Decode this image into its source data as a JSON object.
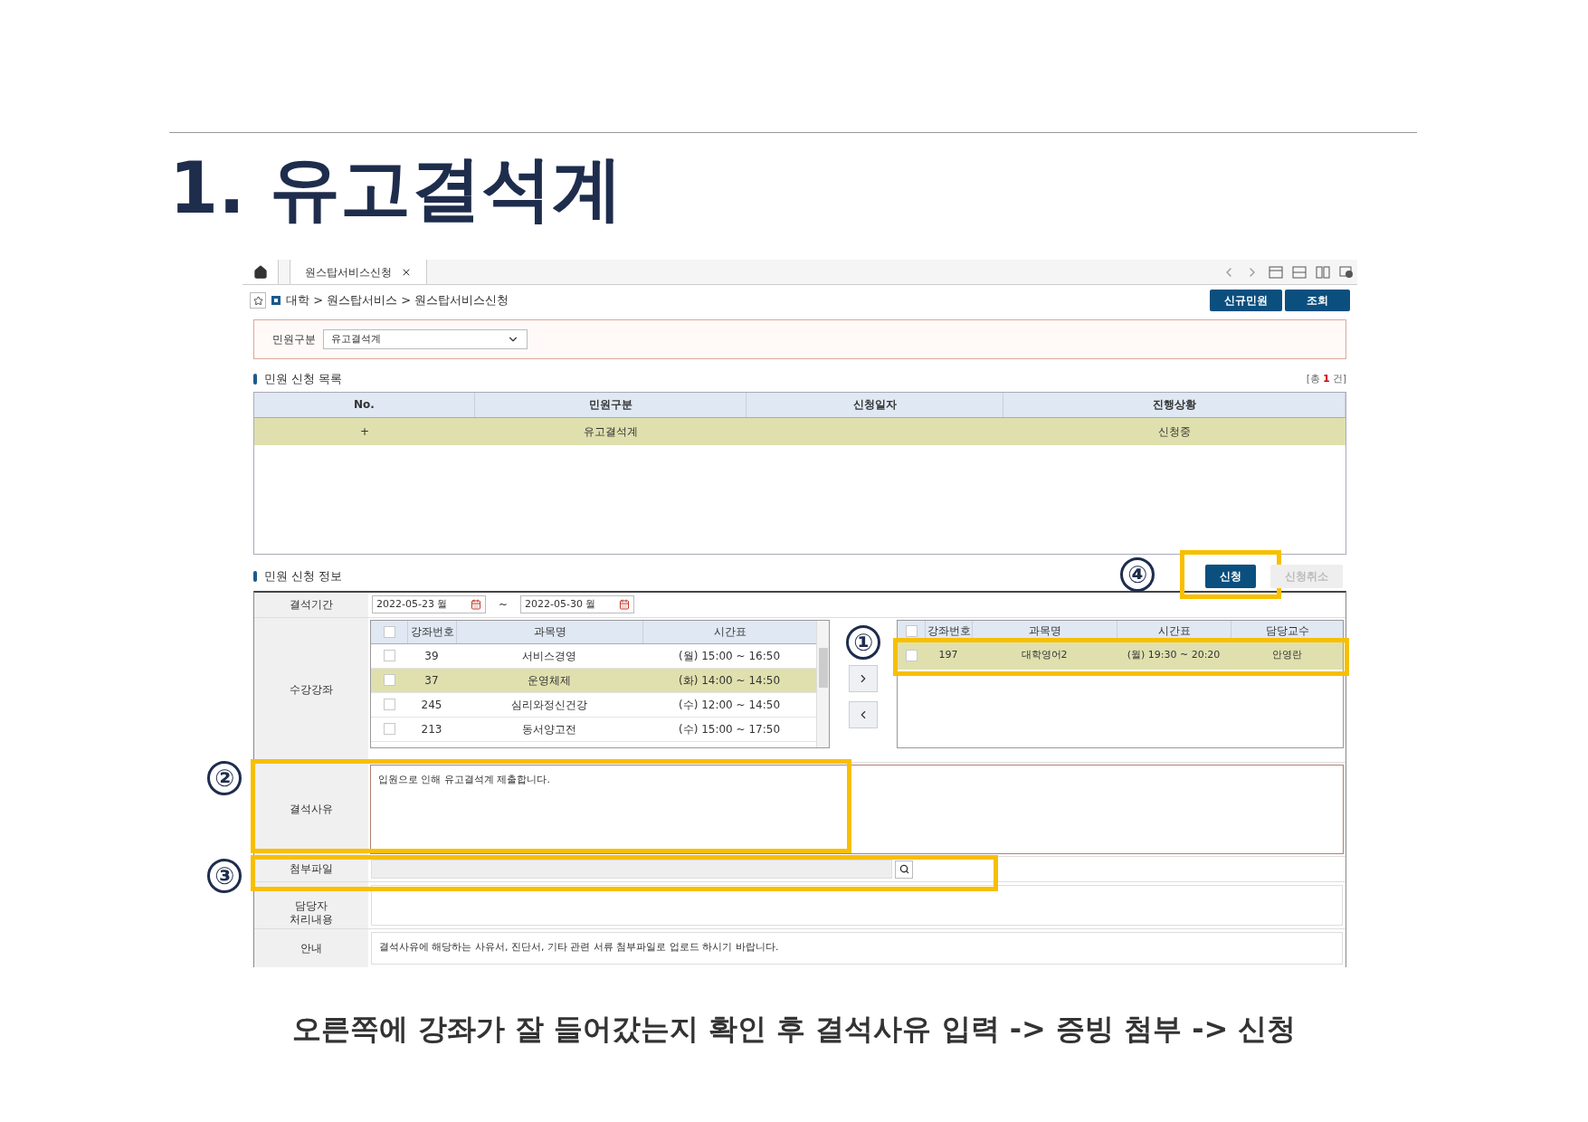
{
  "slide": {
    "title": "1. 유고결석계",
    "caption": "오른쪽에 강좌가 잘 들어갔는지 확인 후 결석사유 입력 -> 증빙 첨부 -> 신청"
  },
  "tabs": [
    {
      "label": "원스탑서비스신청",
      "selected": true
    }
  ],
  "breadcrumb": "대학 > 원스탑서비스 > 원스탑서비스신청",
  "header_buttons": [
    "신규민원",
    "조회"
  ],
  "filter": {
    "label": "민원구분",
    "value": "유고결석계"
  },
  "list_section": {
    "title": "민원 신청 목록",
    "count_prefix": "[총",
    "count": "1",
    "count_suffix": "건]",
    "columns": [
      "No.",
      "민원구분",
      "신청일자",
      "진행상황"
    ],
    "rows": [
      {
        "no": "+",
        "type": "유고결석계",
        "status": "신청중",
        "selected": true
      }
    ]
  },
  "info_section": {
    "title": "민원 신청 정보",
    "buttons": [
      {
        "label": "신청",
        "disabled": false
      },
      {
        "label": "신청취소",
        "disabled": true
      }
    ]
  },
  "period": {
    "label": "결석기간",
    "start": "2022-05-23 월",
    "separator": "~",
    "end": "2022-05-30 월"
  },
  "courses": {
    "label": "수강강좌",
    "available_all_checked": false,
    "chosen_all_checked": false,
    "available_columns": [
      "강좌번호",
      "과목명",
      "시간표"
    ],
    "available_rows": [
      {
        "code": "39",
        "name": "서비스경영",
        "schedule": "(월) 15:00 ~ 16:50",
        "selected": false,
        "checked": false
      },
      {
        "code": "37",
        "name": "운영체제",
        "schedule": "(화) 14:00 ~ 14:50",
        "selected": true,
        "checked": false
      },
      {
        "code": "245",
        "name": "심리와정신건강",
        "schedule": "(수) 12:00 ~ 14:50",
        "selected": false,
        "checked": false
      },
      {
        "code": "213",
        "name": "동서양고전",
        "schedule": "(수) 15:00 ~ 17:50",
        "selected": false,
        "checked": false
      }
    ],
    "chosen_columns": [
      "강좌번호",
      "과목명",
      "시간표",
      "담당교수"
    ],
    "chosen_rows": [
      {
        "code": "197",
        "name": "대학영어2",
        "schedule": "(월) 19:30 ~ 20:20",
        "professor": "안영란",
        "selected": true,
        "checked": false
      }
    ]
  },
  "reason": {
    "label": "결석사유",
    "value": "입원으로 인해 유고결석계 제출합니다."
  },
  "attachment": {
    "label": "첨부파일"
  },
  "manager_note": {
    "label_lines": [
      "담당자",
      "처리내용"
    ]
  },
  "notice": {
    "label": "안내",
    "text": "결석사유에 해당하는 사유서, 진단서, 기타 관련 서류 첨부파일로 업로드 하시기 바랍니다."
  },
  "annotations": [
    "①",
    "②",
    "③",
    "④"
  ]
}
